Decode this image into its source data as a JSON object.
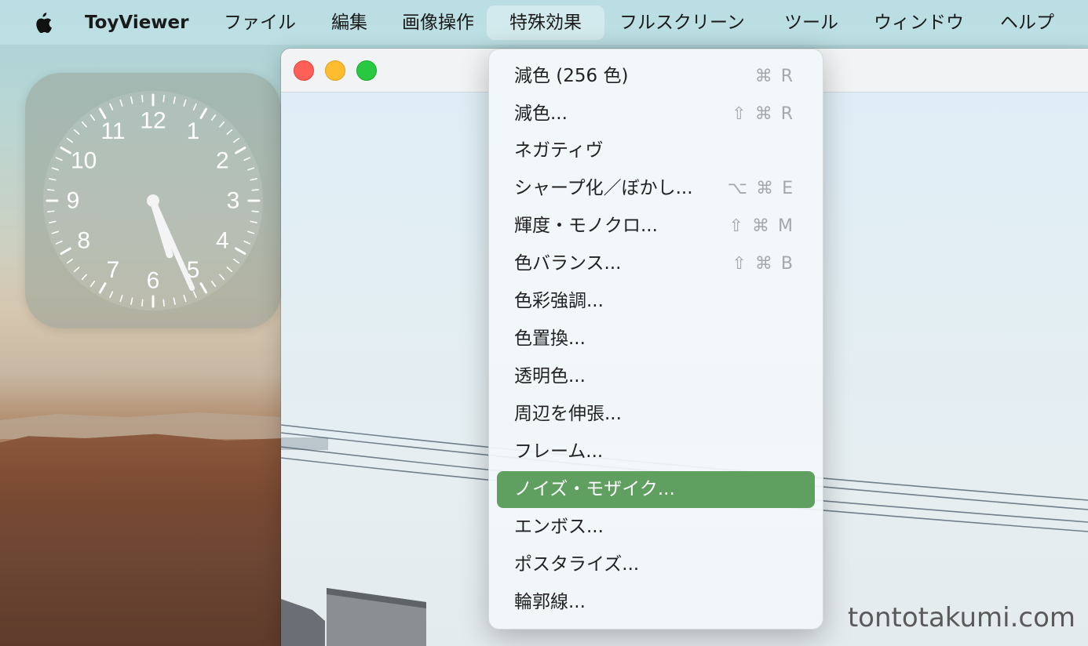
{
  "menubar": {
    "app_name": "ToyViewer",
    "items": [
      {
        "label": "ファイル"
      },
      {
        "label": "編集"
      },
      {
        "label": "画像操作"
      },
      {
        "label": "特殊効果"
      },
      {
        "label": "フルスクリーン"
      },
      {
        "label": "ツール"
      },
      {
        "label": "ウィンドウ"
      },
      {
        "label": "ヘルプ"
      }
    ],
    "active_item": "特殊効果"
  },
  "clock": {
    "numbers": [
      "12",
      "1",
      "2",
      "3",
      "4",
      "5",
      "6",
      "7",
      "8",
      "9",
      "10",
      "11"
    ],
    "time": {
      "hour": 5,
      "minute": 26
    }
  },
  "dropdown": {
    "items": [
      {
        "label": "減色 (256 色)",
        "shortcut": "⌘ R"
      },
      {
        "label": "減色...",
        "shortcut": "⇧ ⌘ R"
      },
      {
        "label": "ネガティヴ",
        "shortcut": ""
      },
      {
        "label": "シャープ化／ぼかし...",
        "shortcut": "⌥ ⌘ E"
      },
      {
        "label": "輝度・モノクロ...",
        "shortcut": "⇧ ⌘ M"
      },
      {
        "label": "色バランス...",
        "shortcut": "⇧ ⌘ B"
      },
      {
        "label": "色彩強調...",
        "shortcut": ""
      },
      {
        "label": "色置換...",
        "shortcut": ""
      },
      {
        "label": "透明色...",
        "shortcut": ""
      },
      {
        "label": "周辺を伸張...",
        "shortcut": ""
      },
      {
        "label": "フレーム...",
        "shortcut": ""
      },
      {
        "label": "ノイズ・モザイク...",
        "shortcut": ""
      },
      {
        "label": "エンボス...",
        "shortcut": ""
      },
      {
        "label": "ポスタライズ...",
        "shortcut": ""
      },
      {
        "label": "輪郭線...",
        "shortcut": ""
      }
    ],
    "selected_index": 11
  },
  "watermark": "tontotakumi.com",
  "colors": {
    "selection": "#5fa060",
    "close": "#fe5f57",
    "minimize": "#febc2e",
    "maximize": "#28c840"
  }
}
